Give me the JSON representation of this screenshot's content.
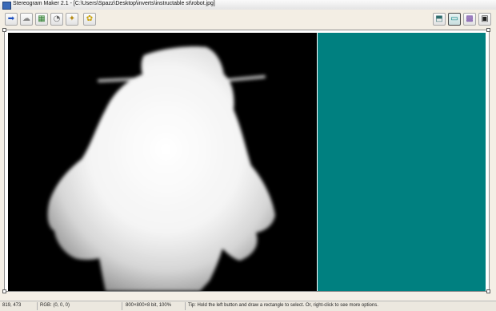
{
  "window": {
    "title": "Stereogram Maker 2.1 - [C:\\Users\\Spazz\\Desktop\\inverts\\instructable st\\robot.jpg]"
  },
  "toolbar": {
    "left_buttons": [
      {
        "name": "open-icon",
        "glyph": "➡"
      },
      {
        "name": "depth-map-icon",
        "glyph": "☁"
      },
      {
        "name": "generate-icon",
        "glyph": "▦"
      },
      {
        "name": "texture-icon",
        "glyph": "◔"
      },
      {
        "name": "wizard-icon",
        "glyph": "✦"
      },
      {
        "name": "animate-icon",
        "glyph": "✿"
      }
    ],
    "right_buttons": [
      {
        "name": "layer-icon",
        "glyph": "⬒"
      },
      {
        "name": "view-icon",
        "glyph": "▭"
      },
      {
        "name": "palette-icon",
        "glyph": "▩"
      },
      {
        "name": "film-icon",
        "glyph": "▣"
      }
    ]
  },
  "colors": {
    "pattern": "#008080",
    "depth_background": "#000000"
  },
  "statusbar": {
    "coords": "819, 473",
    "rgb": "RGB: (0, 0, 0)",
    "info": "800×800×8 bit, 100%",
    "tip": "Tip: Hold the left button and draw a rectangle to select. Or, right-click to see more options."
  }
}
